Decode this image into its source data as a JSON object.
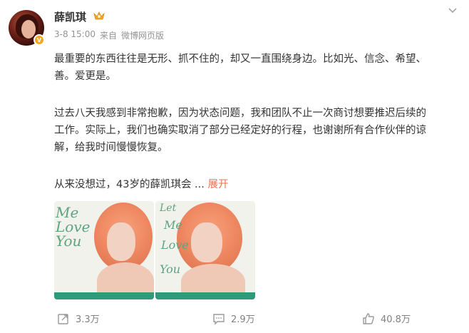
{
  "post": {
    "author": "薛凯琪",
    "avatar_badge": "V",
    "date": "3-8 15:00",
    "source_prefix": "来自",
    "source": "微博网页版",
    "paragraph1_line1": "最重要的东西往往是无形、抓不住的，却又一直围绕身边。比如光、信念、希望、",
    "paragraph1_line2": "善。爱更是。",
    "paragraph2_line1": "过去八天我感到非常抱歉，因为状态问题，我和团队不止一次商讨想要推迟后续的",
    "paragraph2_line2": "工作。实际上，我们也确实取消了部分已经定好的行程，也谢谢所有合作伙伴的谅",
    "paragraph2_line3": "解，给我时间慢慢恢复。",
    "paragraph3": "从来没想过，43岁的薛凯琪会 ... ",
    "expand_label": "展开"
  },
  "images": {
    "poster1_title": "Me Love You",
    "poster2_title_1": "Let",
    "poster2_title_2": "Me",
    "poster2_title_3": "Love",
    "poster2_title_4": "You"
  },
  "actions": {
    "repost_count": "3.3万",
    "comment_count": "2.9万",
    "like_count": "40.8万"
  },
  "colors": {
    "link": "#eb7350",
    "meta": "#939393",
    "vip": "#f5a623"
  }
}
